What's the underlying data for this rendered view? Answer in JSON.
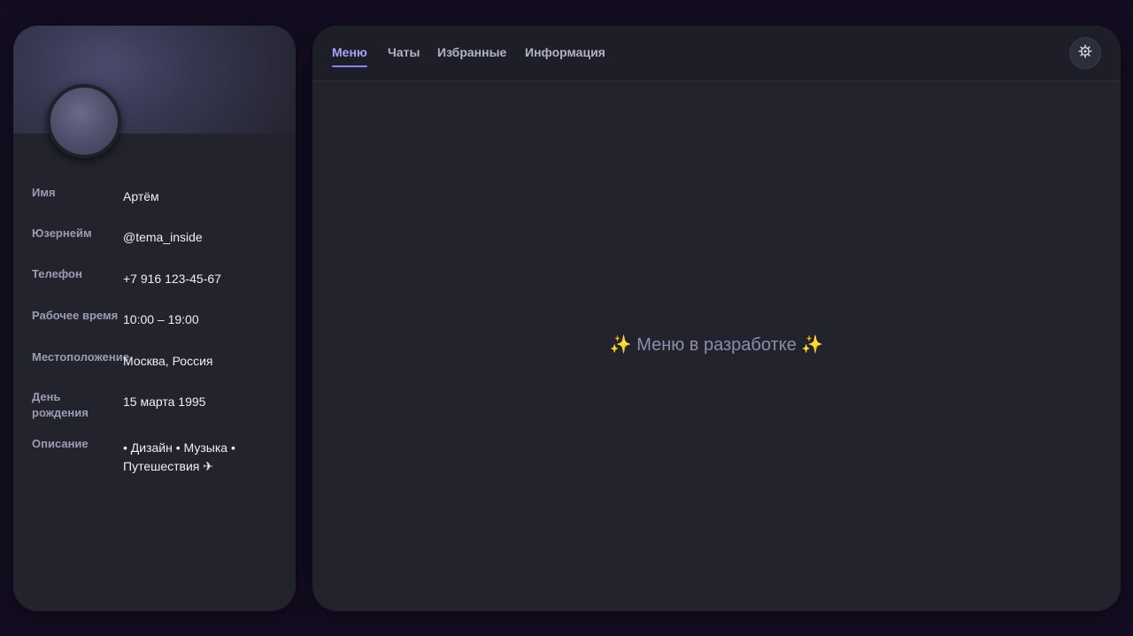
{
  "profile": {
    "fields": [
      {
        "label": "Имя",
        "value": "Артём"
      },
      {
        "label": "Юзернейм",
        "value": "@tema_inside"
      },
      {
        "label": "Телефон",
        "value": "+7 916 123-45-67"
      },
      {
        "label": "Рабочее время",
        "value": "10:00 – 19:00"
      },
      {
        "label": "Местоположение",
        "value": "Москва, Россия"
      },
      {
        "label": "День рождения",
        "value": "15 марта 1995"
      },
      {
        "label": "Описание",
        "value": "• Дизайн • Музыка • Путешествия ✈"
      }
    ]
  },
  "tabs": [
    {
      "label": "Меню",
      "active": true
    },
    {
      "label": "Чаты",
      "active": false
    },
    {
      "label": "Избранные",
      "active": false
    },
    {
      "label": "Информация",
      "active": false
    }
  ],
  "settings_icon": "gear-icon",
  "content": {
    "placeholder_text": "Меню в разработке",
    "decoration_icon": "sparkles-icon"
  },
  "colors": {
    "background": "#140d22",
    "panel": "#22232d",
    "accent": "#8b84ef"
  }
}
